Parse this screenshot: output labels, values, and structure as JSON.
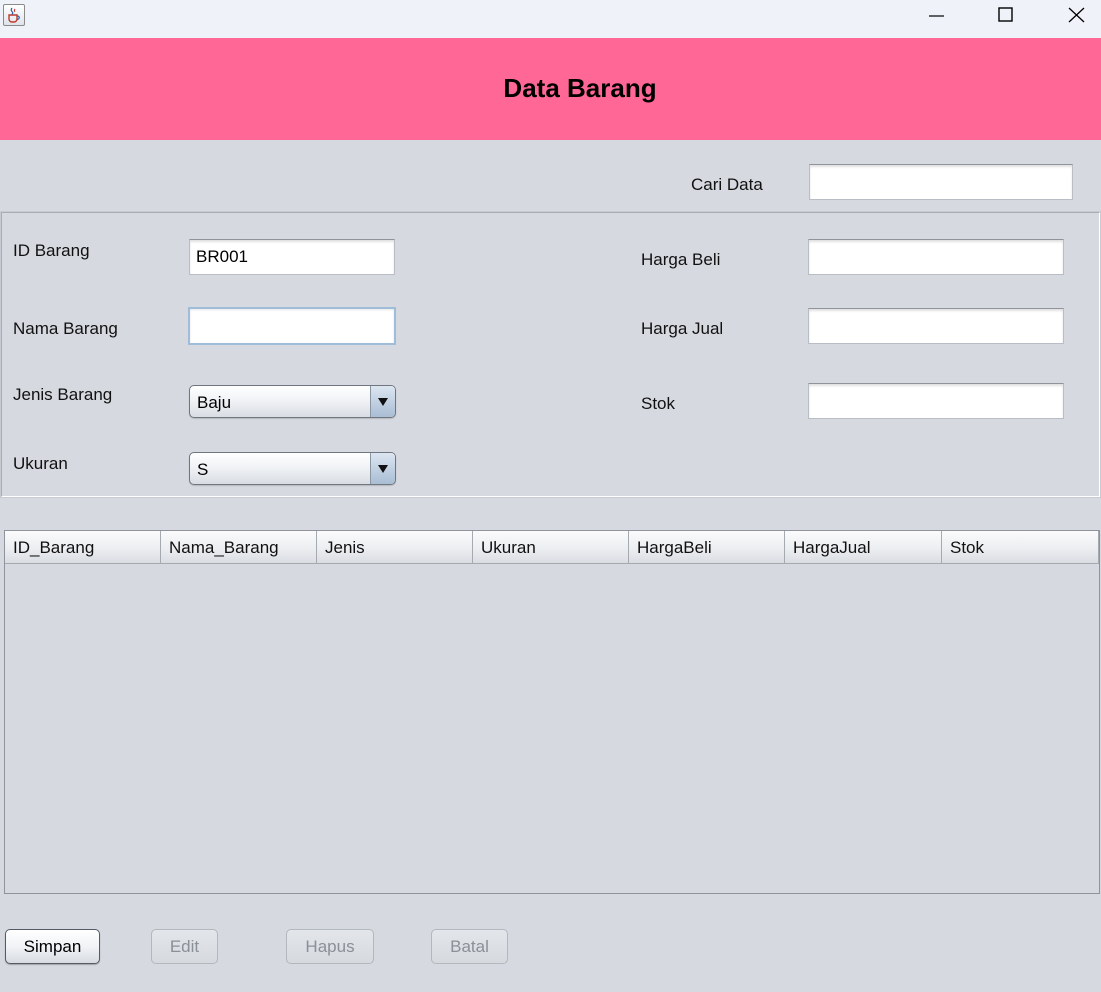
{
  "window": {
    "app_icon": "java-cup-icon",
    "controls": [
      "minimize-icon",
      "maximize-icon",
      "close-icon"
    ]
  },
  "header": {
    "title": "Data Barang",
    "background": "#ff6796"
  },
  "search": {
    "label": "Cari Data",
    "value": ""
  },
  "form": {
    "id_barang": {
      "label": "ID Barang",
      "value": "BR001"
    },
    "nama_barang": {
      "label": "Nama Barang",
      "value": ""
    },
    "jenis_barang": {
      "label": "Jenis Barang",
      "selected": "Baju"
    },
    "ukuran": {
      "label": "Ukuran",
      "selected": "S"
    },
    "harga_beli": {
      "label": "Harga Beli",
      "value": ""
    },
    "harga_jual": {
      "label": "Harga Jual",
      "value": ""
    },
    "stok": {
      "label": "Stok",
      "value": ""
    }
  },
  "table": {
    "columns": [
      "ID_Barang",
      "Nama_Barang",
      "Jenis",
      "Ukuran",
      "HargaBeli",
      "HargaJual",
      "Stok"
    ],
    "rows": []
  },
  "buttons": {
    "simpan": {
      "label": "Simpan",
      "enabled": true
    },
    "edit": {
      "label": "Edit",
      "enabled": false
    },
    "hapus": {
      "label": "Hapus",
      "enabled": false
    },
    "batal": {
      "label": "Batal",
      "enabled": false
    }
  }
}
